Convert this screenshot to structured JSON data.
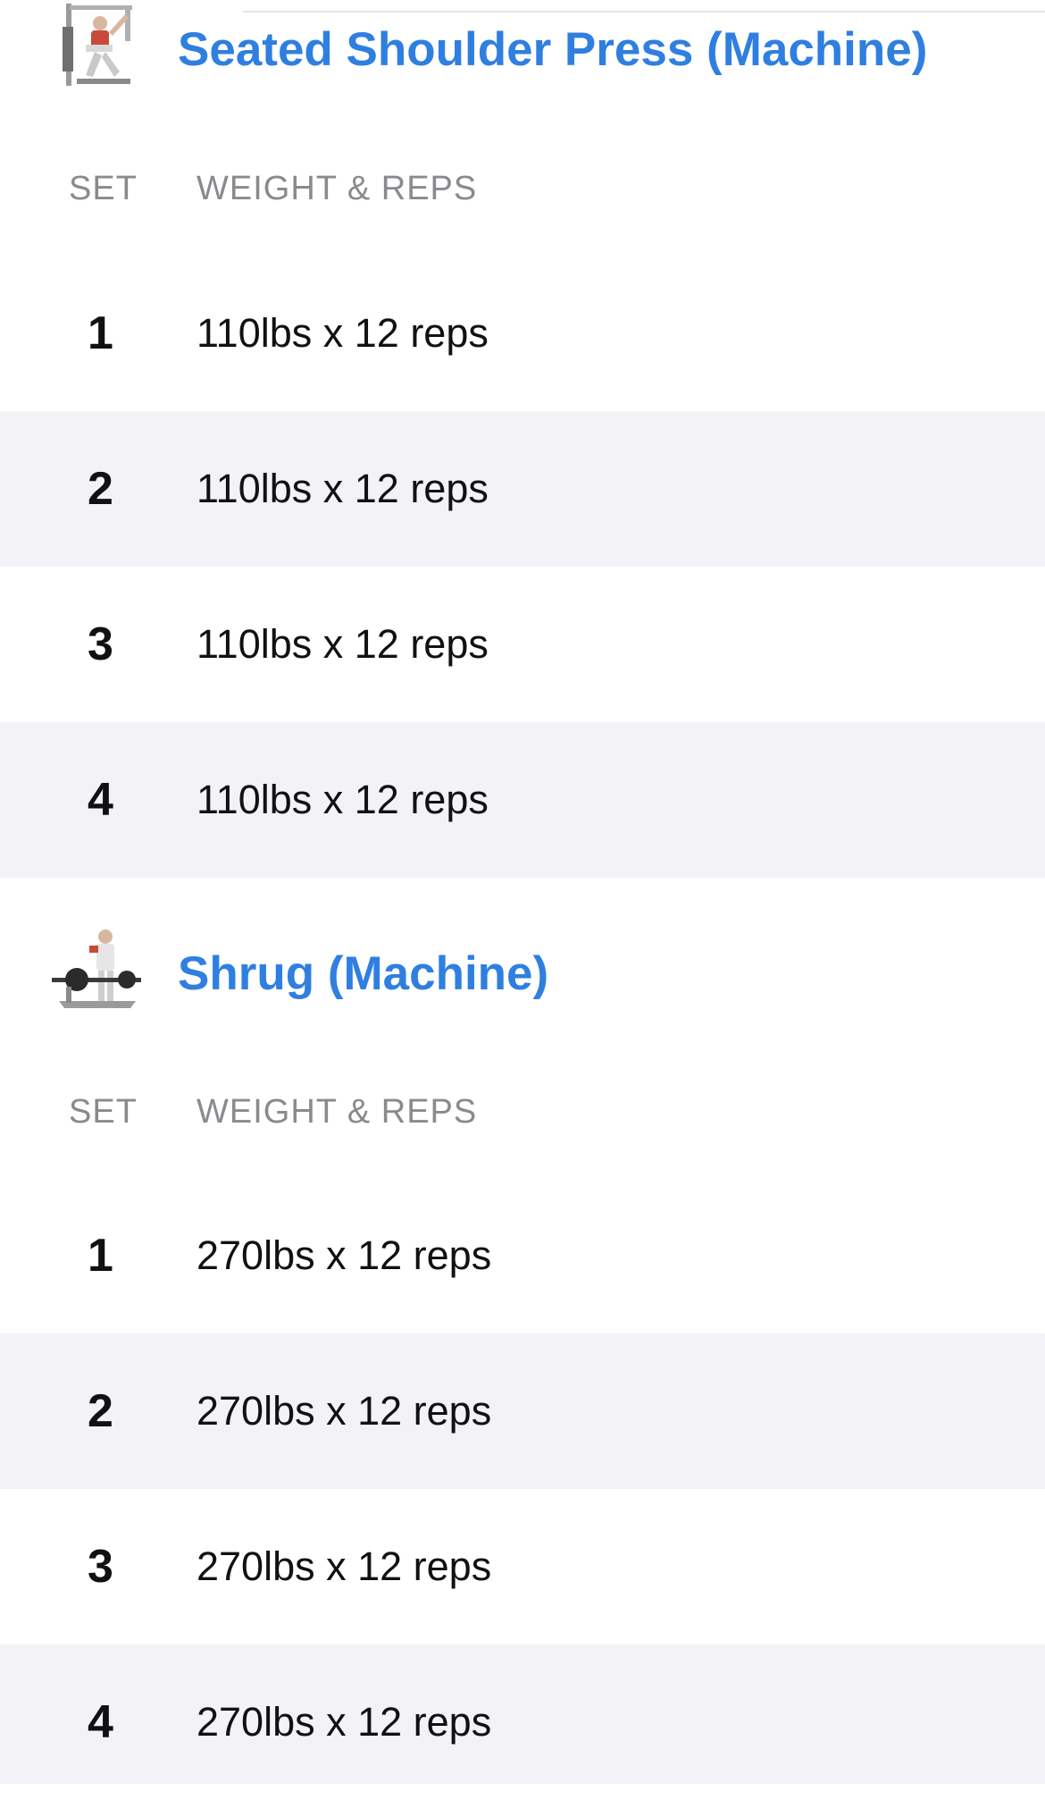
{
  "exercises": [
    {
      "name": "Seated Shoulder Press (Machine)",
      "thumbnail_icon": "shoulder-press-machine-icon",
      "columns": {
        "set": "SET",
        "weight_reps": "WEIGHT & REPS"
      },
      "sets": [
        {
          "number": "1",
          "value": "110lbs x 12 reps"
        },
        {
          "number": "2",
          "value": "110lbs x 12 reps"
        },
        {
          "number": "3",
          "value": "110lbs x 12 reps"
        },
        {
          "number": "4",
          "value": "110lbs x 12 reps"
        }
      ]
    },
    {
      "name": "Shrug (Machine)",
      "thumbnail_icon": "shrug-machine-icon",
      "columns": {
        "set": "SET",
        "weight_reps": "WEIGHT & REPS"
      },
      "sets": [
        {
          "number": "1",
          "value": "270lbs x 12 reps"
        },
        {
          "number": "2",
          "value": "270lbs x 12 reps"
        },
        {
          "number": "3",
          "value": "270lbs x 12 reps"
        },
        {
          "number": "4",
          "value": "270lbs x 12 reps"
        }
      ]
    }
  ],
  "colors": {
    "accent": "#2f7fe0",
    "row_shade": "#f2f2f7",
    "header_gray": "#8a8a8e",
    "text": "#111111"
  }
}
